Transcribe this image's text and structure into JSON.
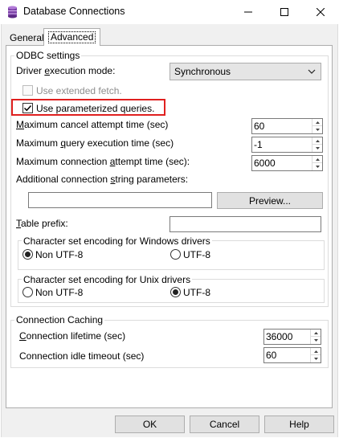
{
  "window": {
    "title": "Database Connections"
  },
  "tabs": [
    {
      "label": "General",
      "selected": false
    },
    {
      "label": "Advanced",
      "selected": true
    }
  ],
  "odbc": {
    "group_title": "ODBC settings",
    "driver_mode": {
      "label_pre": "Driver ",
      "label_accel": "e",
      "label_post": "xecution mode:",
      "value": "Synchronous"
    },
    "extended_fetch": {
      "label": "Use extended fetch.",
      "checked": false,
      "disabled": true
    },
    "parameterized": {
      "label": "Use parameterized queries.",
      "checked": true,
      "highlighted": true
    },
    "max_cancel": {
      "label_accel": "M",
      "label_post": "aximum cancel attempt time (sec)",
      "value": "60"
    },
    "max_query": {
      "label_pre": "Maximum ",
      "label_accel": "q",
      "label_post": "uery execution time (sec)",
      "value": "-1"
    },
    "max_connection": {
      "label_pre": "Maximum connection ",
      "label_accel": "a",
      "label_post": "ttempt time (sec):",
      "value": "6000"
    },
    "additional": {
      "label_pre": "Additional connection ",
      "label_accel": "s",
      "label_post": "tring parameters:",
      "value": "",
      "preview_label": "Preview..."
    },
    "table_prefix": {
      "label_accel": "T",
      "label_post": "able prefix:",
      "value": ""
    },
    "windows_encoding": {
      "title": "Character set encoding for Windows drivers",
      "options": [
        {
          "label": "Non UTF-8",
          "selected": true
        },
        {
          "label": "UTF-8",
          "selected": false
        }
      ]
    },
    "unix_encoding": {
      "title": "Character set encoding for Unix drivers",
      "options": [
        {
          "label": "Non UTF-8",
          "selected": false
        },
        {
          "label": "UTF-8",
          "selected": true
        }
      ]
    }
  },
  "caching": {
    "group_title": "Connection Caching",
    "lifetime": {
      "label_accel": "C",
      "label_post": "onnection lifetime (sec)",
      "value": "36000"
    },
    "idle_timeout": {
      "label": "Connection idle timeout (sec)",
      "value": "60"
    }
  },
  "footer": {
    "ok_label": "OK",
    "cancel_label": "Cancel",
    "help_label": "Help"
  },
  "colors": {
    "highlight_border": "#e0201f",
    "window_bg": "#f0f0f0",
    "panel_bg": "#ffffff"
  },
  "icons": {
    "app": "database-icon",
    "dropdown": "chevron-down-icon",
    "spin_up": "spin-up-arrow-icon",
    "spin_down": "spin-down-arrow-icon"
  }
}
